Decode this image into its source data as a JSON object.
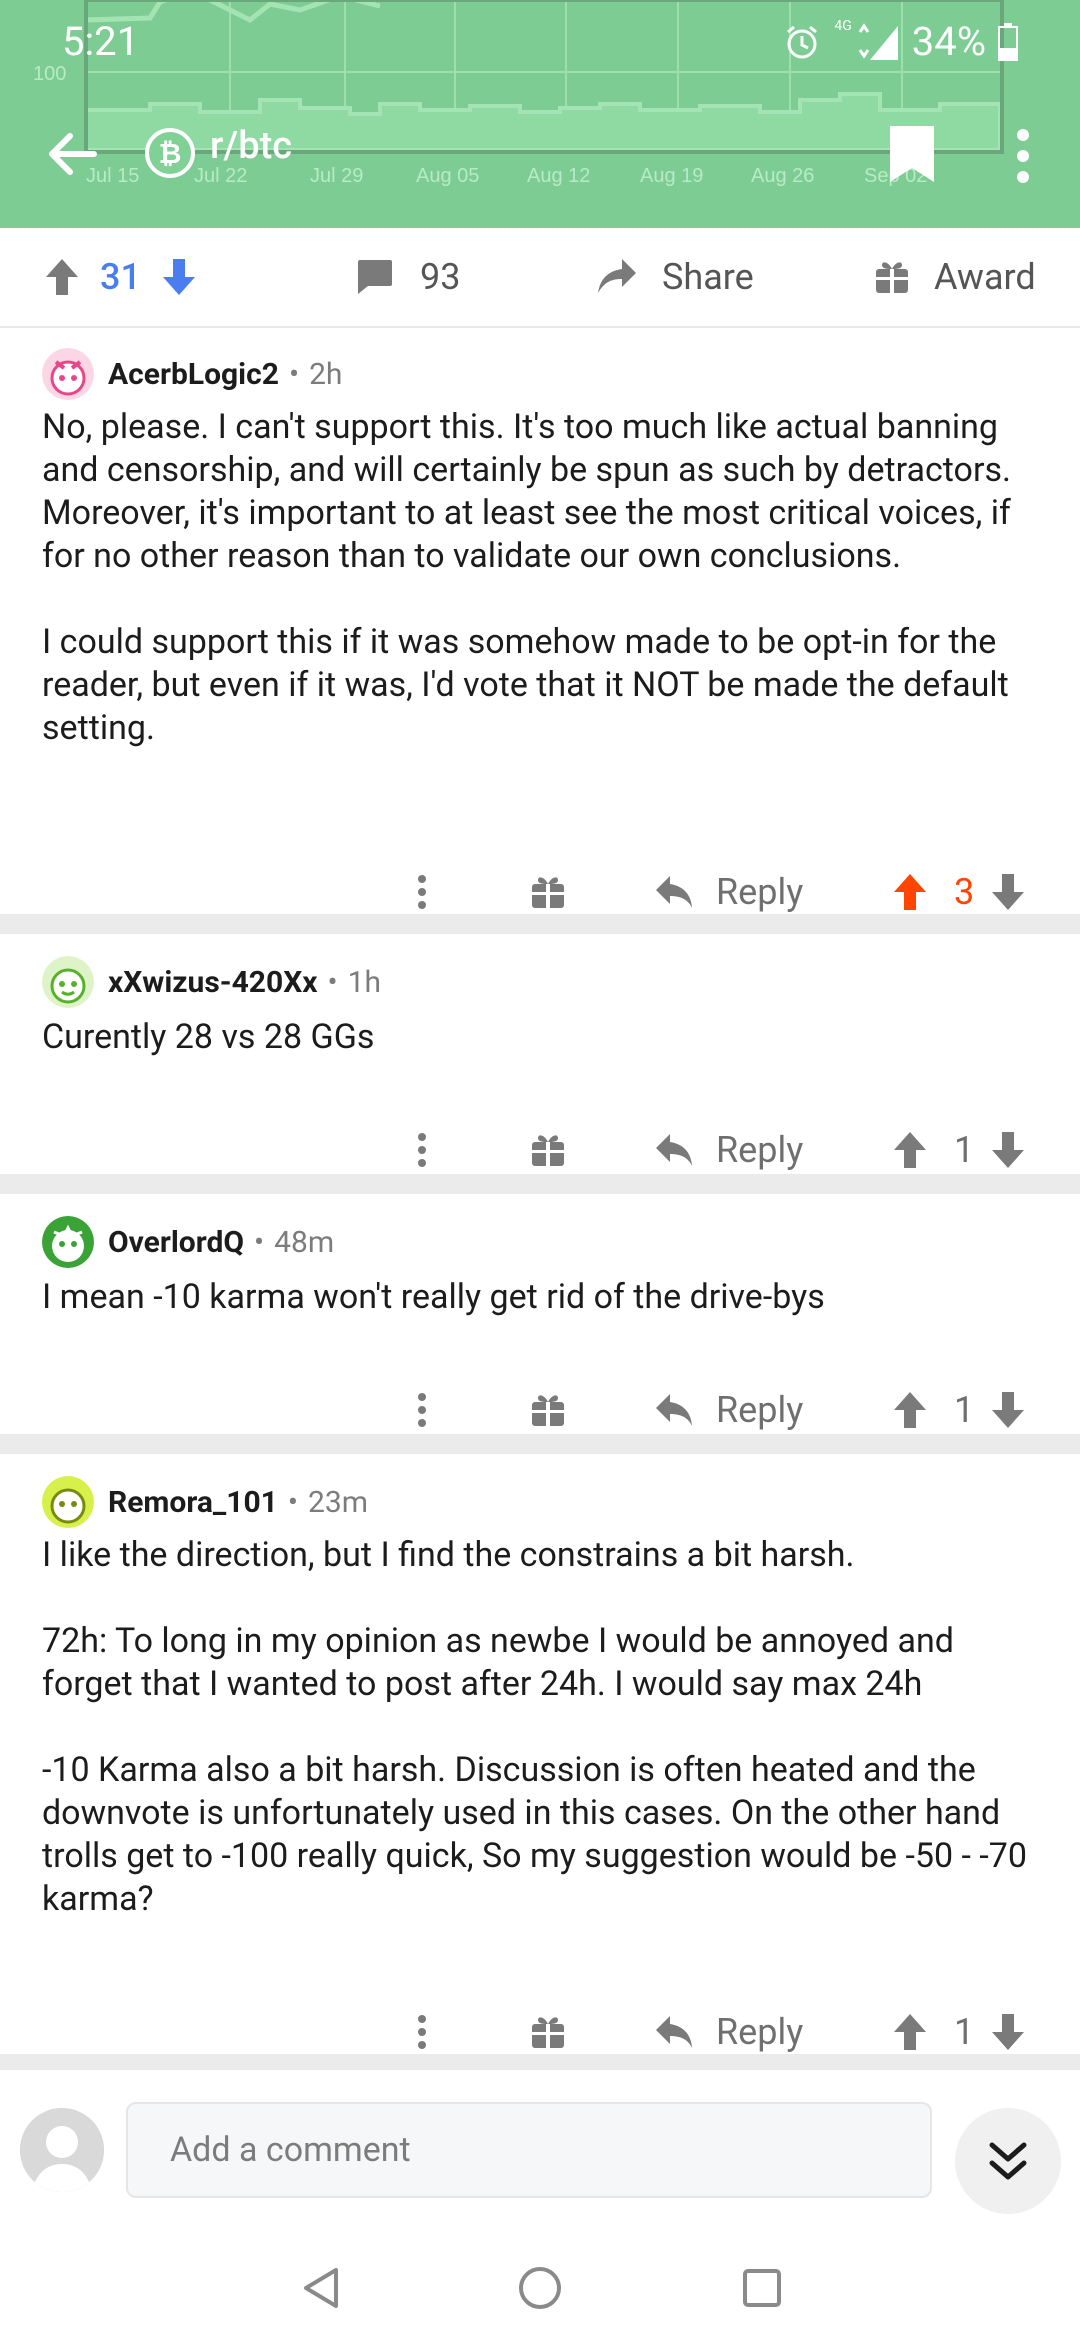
{
  "status_bar": {
    "time": "5:21",
    "battery": "34%",
    "network": "4G"
  },
  "chart_axis": {
    "y_tick": "100",
    "x_ticks": [
      "Jul 15",
      "Jul 22",
      "Jul 29",
      "Aug 05",
      "Aug 12",
      "Aug 19",
      "Aug 26",
      "Sep 02"
    ]
  },
  "header": {
    "subreddit": "r/btc"
  },
  "post_actions": {
    "score": "31",
    "comments": "93",
    "share": "Share",
    "award": "Award"
  },
  "colors": {
    "header_green": "#7fd196",
    "upvote_orange": "#ff4500",
    "vote_blue": "#4a7ef0"
  },
  "comments": [
    {
      "user": "AcerbLogic2",
      "age": "2h",
      "body": "No, please. I can't support this. It's too much like actual banning and censorship, and will certainly be spun as such by detractors. Moreover, it's important to at least see the most critical voices, if for no other reason than to validate our own conclusions.\n\nI could support this if it was somehow made to be opt-in for the reader, but even if it was, I'd vote that it NOT be made the default setting.",
      "reply": "Reply",
      "score": "3",
      "upvoted": true
    },
    {
      "user": "xXwizus-420Xx",
      "age": "1h",
      "body": "Curently 28 vs 28 GGs",
      "reply": "Reply",
      "score": "1"
    },
    {
      "user": "OverlordQ",
      "age": "48m",
      "body": "I mean -10 karma won't really get rid of the drive-bys",
      "reply": "Reply",
      "score": "1"
    },
    {
      "user": "Remora_101",
      "age": "23m",
      "body": "I like the direction, but I find the constrains a bit harsh.\n\n72h: To long in my opinion as newbe I would be annoyed and forget that I wanted to post after 24h. I would say max 24h\n\n-10 Karma also a bit harsh. Discussion is often heated and the downvote is unfortunately used in this cases. On the other hand trolls get to -100 really quick, So my suggestion would be -50 - -70 karma?",
      "reply": "Reply",
      "score": "1"
    }
  ],
  "composer": {
    "placeholder": "Add a comment"
  }
}
